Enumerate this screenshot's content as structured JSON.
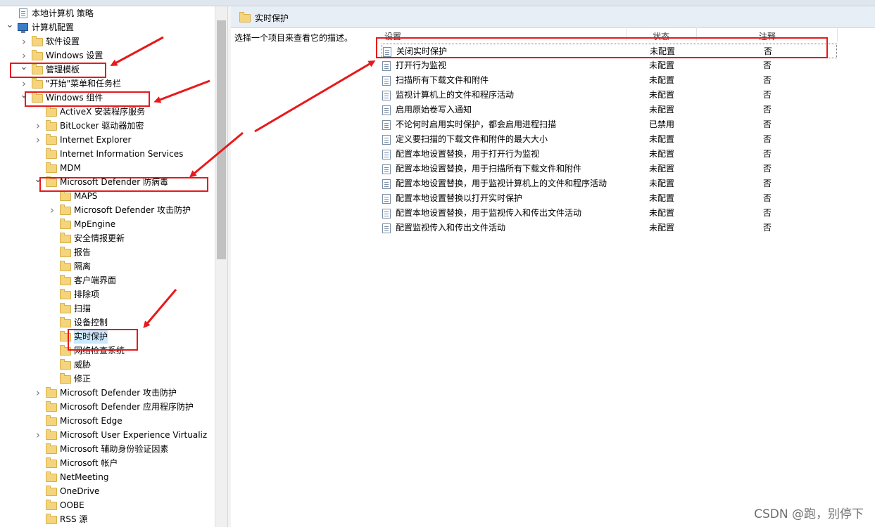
{
  "tree": {
    "items": [
      {
        "label": "本地计算机 策略",
        "icon": "policy-icon",
        "arrow": "none",
        "indent": 0
      },
      {
        "label": "计算机配置",
        "icon": "computer-icon",
        "arrow": "expanded",
        "indent": 1
      },
      {
        "label": "软件设置",
        "icon": "folder-icon",
        "arrow": "collapsed",
        "indent": 2
      },
      {
        "label": "Windows 设置",
        "icon": "folder-icon",
        "arrow": "collapsed",
        "indent": 2
      },
      {
        "label": "管理模板",
        "icon": "folder-icon",
        "arrow": "expanded",
        "indent": 2
      },
      {
        "label": "\"开始\"菜单和任务栏",
        "icon": "folder-icon",
        "arrow": "collapsed",
        "indent": 3
      },
      {
        "label": "Windows 组件",
        "icon": "folder-icon",
        "arrow": "expanded",
        "indent": 3
      },
      {
        "label": "ActiveX 安装程序服务",
        "icon": "folder-icon",
        "arrow": "none",
        "indent": 4
      },
      {
        "label": "BitLocker 驱动器加密",
        "icon": "folder-icon",
        "arrow": "collapsed",
        "indent": 4
      },
      {
        "label": "Internet Explorer",
        "icon": "folder-icon",
        "arrow": "collapsed",
        "indent": 4
      },
      {
        "label": "Internet Information Services",
        "icon": "folder-icon",
        "arrow": "none",
        "indent": 4
      },
      {
        "label": "MDM",
        "icon": "folder-icon",
        "arrow": "none",
        "indent": 4
      },
      {
        "label": "Microsoft Defender 防病毒",
        "icon": "folder-icon",
        "arrow": "expanded",
        "indent": 4
      },
      {
        "label": "MAPS",
        "icon": "folder-icon",
        "arrow": "none",
        "indent": 5
      },
      {
        "label": "Microsoft Defender 攻击防护",
        "icon": "folder-icon",
        "arrow": "collapsed",
        "indent": 5
      },
      {
        "label": "MpEngine",
        "icon": "folder-icon",
        "arrow": "none",
        "indent": 5
      },
      {
        "label": "安全情报更新",
        "icon": "folder-icon",
        "arrow": "none",
        "indent": 5
      },
      {
        "label": "报告",
        "icon": "folder-icon",
        "arrow": "none",
        "indent": 5
      },
      {
        "label": "隔离",
        "icon": "folder-icon",
        "arrow": "none",
        "indent": 5
      },
      {
        "label": "客户端界面",
        "icon": "folder-icon",
        "arrow": "none",
        "indent": 5
      },
      {
        "label": "排除项",
        "icon": "folder-icon",
        "arrow": "none",
        "indent": 5
      },
      {
        "label": "扫描",
        "icon": "folder-icon",
        "arrow": "none",
        "indent": 5
      },
      {
        "label": "设备控制",
        "icon": "folder-icon",
        "arrow": "none",
        "indent": 5
      },
      {
        "label": "实时保护",
        "icon": "folder-icon",
        "arrow": "none",
        "indent": 5,
        "selected": true
      },
      {
        "label": "网络检查系统",
        "icon": "folder-icon",
        "arrow": "none",
        "indent": 5
      },
      {
        "label": "威胁",
        "icon": "folder-icon",
        "arrow": "none",
        "indent": 5
      },
      {
        "label": "修正",
        "icon": "folder-icon",
        "arrow": "none",
        "indent": 5
      },
      {
        "label": "Microsoft Defender 攻击防护",
        "icon": "folder-icon",
        "arrow": "collapsed",
        "indent": 4
      },
      {
        "label": "Microsoft Defender 应用程序防护",
        "icon": "folder-icon",
        "arrow": "none",
        "indent": 4
      },
      {
        "label": "Microsoft Edge",
        "icon": "folder-icon",
        "arrow": "none",
        "indent": 4
      },
      {
        "label": "Microsoft User Experience Virtualiz",
        "icon": "folder-icon",
        "arrow": "collapsed",
        "indent": 4
      },
      {
        "label": "Microsoft 辅助身份验证因素",
        "icon": "folder-icon",
        "arrow": "none",
        "indent": 4
      },
      {
        "label": "Microsoft 帐户",
        "icon": "folder-icon",
        "arrow": "none",
        "indent": 4
      },
      {
        "label": "NetMeeting",
        "icon": "folder-icon",
        "arrow": "none",
        "indent": 4
      },
      {
        "label": "OneDrive",
        "icon": "folder-icon",
        "arrow": "none",
        "indent": 4
      },
      {
        "label": "OOBE",
        "icon": "folder-icon",
        "arrow": "none",
        "indent": 4
      },
      {
        "label": "RSS 源",
        "icon": "folder-icon",
        "arrow": "none",
        "indent": 4
      }
    ]
  },
  "right": {
    "title": "实时保护",
    "description": "选择一个项目来查看它的描述。",
    "columns": {
      "setting": "设置",
      "state": "状态",
      "note": "注释"
    },
    "policies": [
      {
        "name": "关闭实时保护",
        "state": "未配置",
        "note": "否"
      },
      {
        "name": "打开行为监视",
        "state": "未配置",
        "note": "否"
      },
      {
        "name": "扫描所有下载文件和附件",
        "state": "未配置",
        "note": "否"
      },
      {
        "name": "监视计算机上的文件和程序活动",
        "state": "未配置",
        "note": "否"
      },
      {
        "name": "启用原始卷写入通知",
        "state": "未配置",
        "note": "否"
      },
      {
        "name": "不论何时启用实时保护，都会启用进程扫描",
        "state": "已禁用",
        "note": "否"
      },
      {
        "name": "定义要扫描的下载文件和附件的最大大小",
        "state": "未配置",
        "note": "否"
      },
      {
        "name": "配置本地设置替换，用于打开行为监视",
        "state": "未配置",
        "note": "否"
      },
      {
        "name": "配置本地设置替换，用于扫描所有下载文件和附件",
        "state": "未配置",
        "note": "否"
      },
      {
        "name": "配置本地设置替换，用于监视计算机上的文件和程序活动",
        "state": "未配置",
        "note": "否"
      },
      {
        "name": "配置本地设置替换以打开实时保护",
        "state": "未配置",
        "note": "否"
      },
      {
        "name": "配置本地设置替换，用于监视传入和传出文件活动",
        "state": "未配置",
        "note": "否"
      },
      {
        "name": "配置监视传入和传出文件活动",
        "state": "未配置",
        "note": "否"
      }
    ]
  },
  "watermark": "CSDN @跑，别停下",
  "colors": {
    "annotation": "#e8191b",
    "selection": "#cce8ff"
  }
}
